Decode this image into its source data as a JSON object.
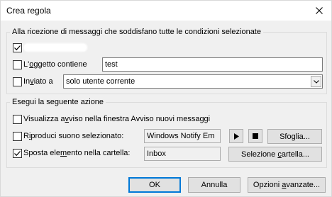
{
  "dialog": {
    "title": "Crea regola"
  },
  "conditions": {
    "group_label": "Alla ricezione di messaggi che soddisfano tutte le condizioni selezionate",
    "sender": {
      "checked": true
    },
    "subject": {
      "checked": false,
      "label_pre": "L'",
      "label_ul": "o",
      "label_post": "ggetto contiene",
      "value": "test"
    },
    "sent_to": {
      "checked": false,
      "label_pre": "In",
      "label_ul": "v",
      "label_post": "iato a",
      "value": "solo utente corrente"
    }
  },
  "actions": {
    "group_label": "Esegui la seguente azione",
    "show_alert": {
      "checked": false,
      "label_pre": "Visualizza a",
      "label_ul": "v",
      "label_post": "viso nella finestra Avviso nuovi messaggi"
    },
    "play_sound": {
      "checked": false,
      "label_pre": "R",
      "label_ul": "i",
      "label_post": "produci suono selezionato:",
      "value": "Windows Notify Em",
      "browse_pre": "Sfo",
      "browse_ul": "g",
      "browse_post": "lia..."
    },
    "move_item": {
      "checked": true,
      "label_pre": "Sposta ele",
      "label_ul": "m",
      "label_post": "ento nella cartella:",
      "value": "Inbox",
      "select_pre": "Selezione ",
      "select_ul": "c",
      "select_post": "artella..."
    }
  },
  "footer": {
    "ok": "OK",
    "cancel": "Annulla",
    "advanced_pre": "Opzioni ",
    "advanced_ul": "a",
    "advanced_post": "vanzate..."
  }
}
